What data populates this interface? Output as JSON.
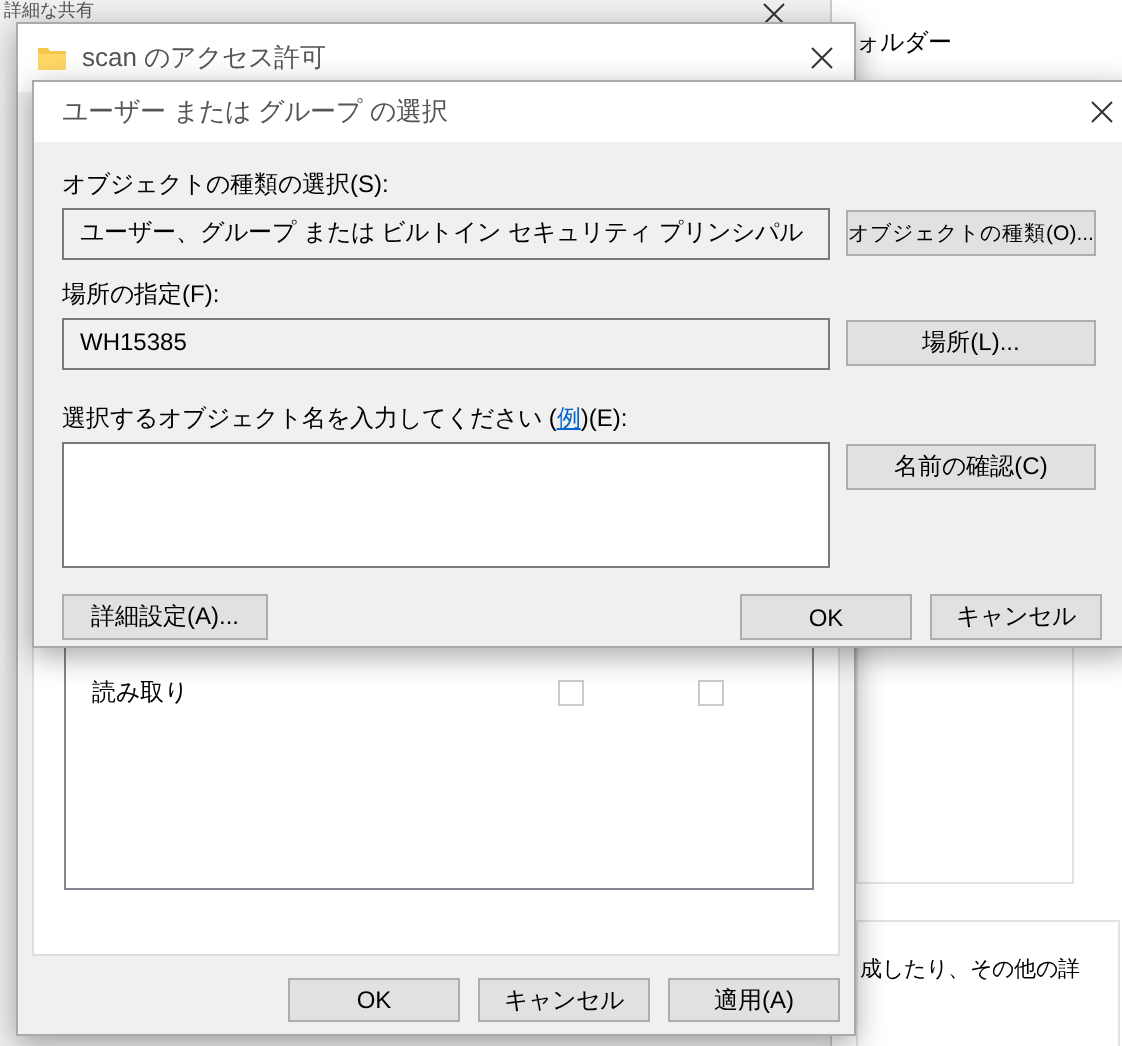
{
  "background_window": {
    "title": "詳細な共有"
  },
  "background_right": {
    "folder_text": "ォルダー",
    "description": "成したり、その他の詳"
  },
  "permissions_window": {
    "title": "scan のアクセス許可",
    "permissions": [
      {
        "name": "読み取り",
        "allow": false,
        "deny": false
      }
    ],
    "buttons": [
      "OK",
      "キャンセル",
      "適用(A)"
    ]
  },
  "select_dialog": {
    "title": "ユーザー または グループ の選択",
    "object_type_label": "オブジェクトの種類の選択(S):",
    "object_type_value": "ユーザー、グループ または ビルトイン セキュリティ プリンシパル",
    "object_type_button": "オブジェクトの種類(O)...",
    "location_label": "場所の指定(F):",
    "location_value": "WH15385",
    "location_button": "場所(L)...",
    "name_prompt_before": "選択するオブジェクト名を入力してください (",
    "name_prompt_link": "例",
    "name_prompt_after": ")(E):",
    "check_names_button": "名前の確認(C)",
    "advanced_button": "詳細設定(A)...",
    "ok_button": "OK",
    "cancel_button": "キャンセル"
  }
}
